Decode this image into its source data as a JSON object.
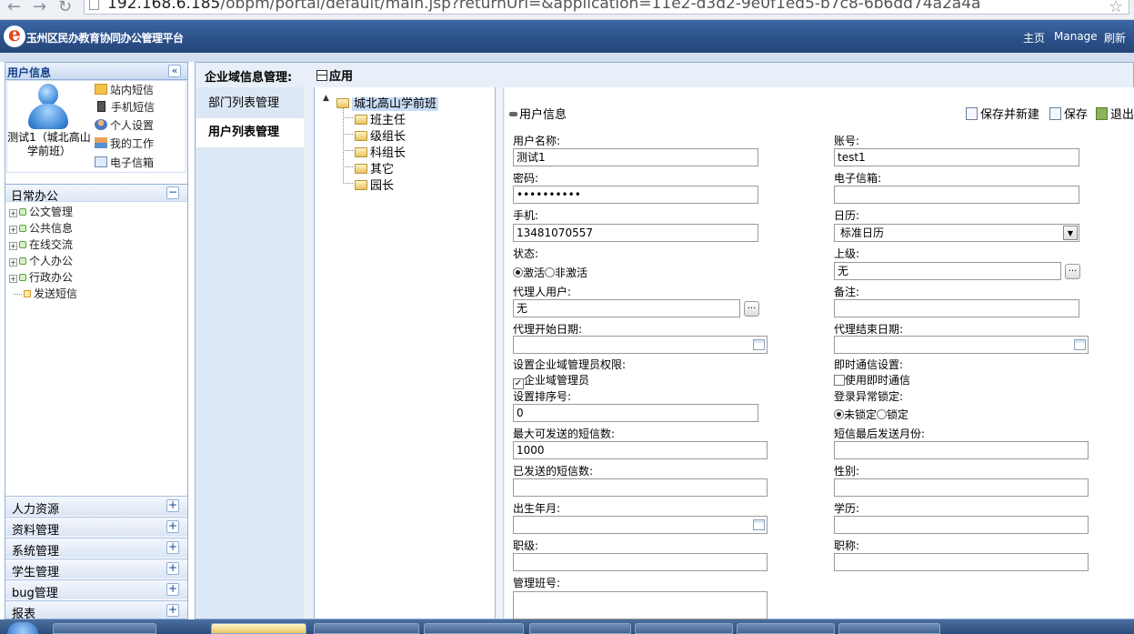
{
  "browser": {
    "url_host": "192.168.6.185",
    "url_rest": "/obpm/portal/default/main.jsp?returnUrl=&application=11e2-d3d2-9e0f1ed5-b7c8-6b6dd74a2a4a"
  },
  "header": {
    "title": "玉州区民办教育协同办公管理平台",
    "links": {
      "home": "主页",
      "manage": "Manage",
      "refresh": "刷新"
    }
  },
  "left": {
    "userinfo_title": "用户信息",
    "user_display": "测试1（城北高山学前班）",
    "quick_links": {
      "site_msg": "站内短信",
      "sms": "手机短信",
      "settings": "个人设置",
      "work": "我的工作",
      "email": "电子信箱"
    },
    "daily": {
      "title": "日常办公",
      "items": [
        "公文管理",
        "公共信息",
        "在线交流",
        "个人办公",
        "行政办公"
      ],
      "leaf": "发送短信"
    },
    "sections": [
      "人力资源",
      "资料管理",
      "系统管理",
      "学生管理",
      "bug管理",
      "报表"
    ]
  },
  "main": {
    "title": "企业域信息管理:",
    "apply": "应用",
    "subnav": [
      "部门列表管理",
      "用户列表管理"
    ],
    "tree": {
      "root": "城北高山学前班",
      "children": [
        "班主任",
        "级组长",
        "科组长",
        "其它",
        "园长"
      ]
    }
  },
  "form": {
    "title": "用户信息",
    "toolbar": {
      "save_new": "保存并新建",
      "save": "保存",
      "exit": "退出"
    },
    "labels": {
      "username": "用户名称:",
      "account": "账号:",
      "password": "密码:",
      "email": "电子信箱:",
      "mobile": "手机:",
      "calendar": "日历:",
      "status": "状态:",
      "superior": "上级:",
      "proxy": "代理人用户:",
      "remark": "备注:",
      "proxy_start": "代理开始日期:",
      "proxy_end": "代理结束日期:",
      "admin_perm": "设置企业域管理员权限:",
      "im_setting": "即时通信设置:",
      "order": "设置排序号:",
      "lock": "登录异常锁定:",
      "max_sms": "最大可发送的短信数:",
      "last_sms_month": "短信最后发送月份:",
      "sent_sms": "已发送的短信数:",
      "gender": "性别:",
      "birth": "出生年月:",
      "education": "学历:",
      "position": "职级:",
      "title_rank": "职称:",
      "class_no": "管理班号:"
    },
    "values": {
      "username": "测试1",
      "account": "test1",
      "password": "••••••••••",
      "email": "",
      "mobile": "13481070557",
      "calendar": "标准日历",
      "superior": "无",
      "proxy": "无",
      "remark": "",
      "order": "0",
      "max_sms": "1000"
    },
    "status_options": [
      "激活",
      "非激活"
    ],
    "admin_checkbox": "企业域管理员",
    "im_checkbox": "使用即时通信",
    "lock_options": [
      "未锁定",
      "锁定"
    ]
  }
}
